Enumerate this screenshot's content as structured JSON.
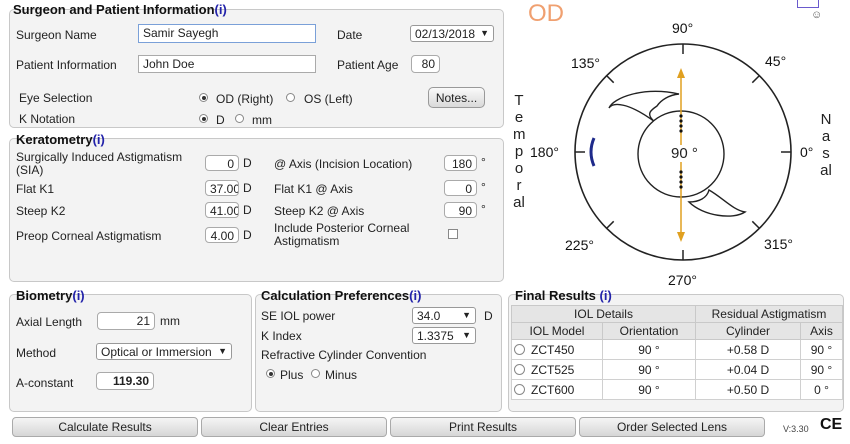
{
  "surgeon_panel": {
    "title": "Surgeon and Patient Information",
    "info_link": "(i)",
    "surgeon_name_label": "Surgeon Name",
    "surgeon_name": "Samir Sayegh",
    "date_label": "Date",
    "date": "02/13/2018",
    "patient_info_label": "Patient Information",
    "patient_info": "John Doe",
    "patient_age_label": "Patient Age",
    "patient_age": "80",
    "eye_selection_label": "Eye Selection",
    "eye_options": [
      "OD (Right)",
      "OS (Left)"
    ],
    "eye_selected": "OD (Right)",
    "notes_button": "Notes...",
    "k_notation_label": "K Notation",
    "k_notation_options": [
      "D",
      "mm"
    ],
    "k_notation_selected": "D"
  },
  "keratometry": {
    "title": "Keratometry",
    "info_link": "(i)",
    "sia_label": "Surgically Induced Astigmatism (SIA)",
    "sia_value": "0",
    "sia_unit": "D",
    "axis_label": "@ Axis (Incision Location)",
    "axis_value": "180",
    "degree_unit": "°",
    "flat_k1_label": "Flat K1",
    "flat_k1": "37.00",
    "flat_k1_unit": "D",
    "flat_k1_axis_label": "Flat K1 @ Axis",
    "flat_k1_axis": "0",
    "steep_k2_label": "Steep K2",
    "steep_k2": "41.00",
    "steep_k2_unit": "D",
    "steep_k2_axis_label": "Steep K2 @ Axis",
    "steep_k2_axis": "90",
    "preop_label": "Preop Corneal Astigmatism",
    "preop_value": "4.00",
    "preop_unit": "D",
    "posterior_label": "Include Posterior Corneal Astigmatism",
    "posterior_checked": false
  },
  "biometry": {
    "title": "Biometry",
    "info_link": "(i)",
    "axial_length_label": "Axial Length",
    "axial_length": "21",
    "axial_length_unit": "mm",
    "method_label": "Method",
    "method": "Optical or Immersion",
    "a_constant_label": "A-constant",
    "a_constant": "119.30"
  },
  "calc_prefs": {
    "title": "Calculation Preferences",
    "info_link": "(i)",
    "se_iol_label": "SE IOL power",
    "se_iol_value": "34.0",
    "se_iol_unit": "D",
    "k_index_label": "K Index",
    "k_index_value": "1.3375",
    "convention_label": "Refractive Cylinder Convention",
    "convention_options": [
      "Plus",
      "Minus"
    ],
    "convention_selected": "Plus"
  },
  "final_results": {
    "title": "Final Results",
    "info_link": "(i)",
    "group_headers": [
      "IOL Details",
      "Residual Astigmatism"
    ],
    "columns": [
      "IOL Model",
      "Orientation",
      "Cylinder",
      "Axis"
    ],
    "rows": [
      {
        "model": "ZCT450",
        "orientation": "90 °",
        "cylinder": "+0.58 D",
        "axis": "90 °"
      },
      {
        "model": "ZCT525",
        "orientation": "90 °",
        "cylinder": "+0.04 D",
        "axis": "90 °"
      },
      {
        "model": "ZCT600",
        "orientation": "90 °",
        "cylinder": "+0.50 D",
        "axis": "0 °"
      }
    ]
  },
  "diagram": {
    "eye_label": "OD",
    "center_label": "90 °",
    "angles": [
      "90°",
      "45°",
      "0°",
      "315°",
      "270°",
      "225°",
      "180°",
      "135°"
    ],
    "left_word": "Temporal",
    "right_word": "Nasal",
    "accent_color": "#f0a070",
    "axis_color": "#e0a020"
  },
  "buttons": {
    "calculate": "Calculate Results",
    "clear": "Clear Entries",
    "print": "Print Results",
    "order": "Order Selected Lens"
  },
  "footer": {
    "version": "V:3.30",
    "ce_mark": "CE"
  }
}
